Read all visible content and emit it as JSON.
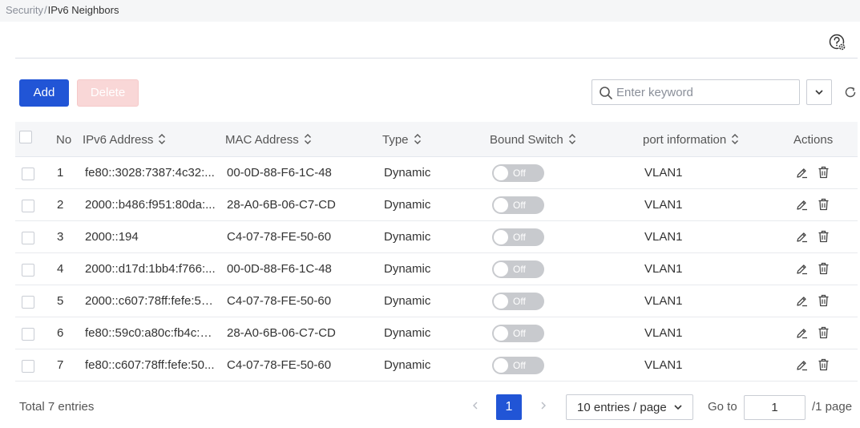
{
  "breadcrumb": {
    "parent": "Security",
    "separator": "/",
    "current": "IPv6 Neighbors"
  },
  "toolbar": {
    "add_label": "Add",
    "delete_label": "Delete",
    "search_placeholder": "Enter keyword",
    "search_value": ""
  },
  "table": {
    "columns": {
      "no": "No",
      "ipv6": "IPv6 Address",
      "mac": "MAC Address",
      "type": "Type",
      "bound": "Bound Switch",
      "port": "port information",
      "actions": "Actions"
    },
    "rows": [
      {
        "no": "1",
        "ipv6": "fe80::3028:7387:4c32:...",
        "mac": "00-0D-88-F6-1C-48",
        "type": "Dynamic",
        "bound": "Off",
        "port": "VLAN1"
      },
      {
        "no": "2",
        "ipv6": "2000::b486:f951:80da:...",
        "mac": "28-A0-6B-06-C7-CD",
        "type": "Dynamic",
        "bound": "Off",
        "port": "VLAN1"
      },
      {
        "no": "3",
        "ipv6": "2000::194",
        "mac": "C4-07-78-FE-50-60",
        "type": "Dynamic",
        "bound": "Off",
        "port": "VLAN1"
      },
      {
        "no": "4",
        "ipv6": "2000::d17d:1bb4:f766:...",
        "mac": "00-0D-88-F6-1C-48",
        "type": "Dynamic",
        "bound": "Off",
        "port": "VLAN1"
      },
      {
        "no": "5",
        "ipv6": "2000::c607:78ff:fefe:50...",
        "mac": "C4-07-78-FE-50-60",
        "type": "Dynamic",
        "bound": "Off",
        "port": "VLAN1"
      },
      {
        "no": "6",
        "ipv6": "fe80::59c0:a80c:fb4c:c...",
        "mac": "28-A0-6B-06-C7-CD",
        "type": "Dynamic",
        "bound": "Off",
        "port": "VLAN1"
      },
      {
        "no": "7",
        "ipv6": "fe80::c607:78ff:fefe:50...",
        "mac": "C4-07-78-FE-50-60",
        "type": "Dynamic",
        "bound": "Off",
        "port": "VLAN1"
      }
    ]
  },
  "pagination": {
    "total": "Total 7 entries",
    "current_page": "1",
    "page_size": "10 entries / page",
    "goto_label": "Go to",
    "goto_value": "1",
    "page_suffix": "/1 page"
  },
  "colors": {
    "primary": "#2155d6",
    "delete_disabled": "#f9d7d7",
    "toggle_off": "#c8cace"
  },
  "icons": {
    "help": "help-settings-icon",
    "search": "search-icon",
    "dropdown": "chevron-down-icon",
    "refresh": "refresh-icon",
    "sort": "sort-icon",
    "edit": "edit-icon",
    "delete": "trash-icon"
  }
}
